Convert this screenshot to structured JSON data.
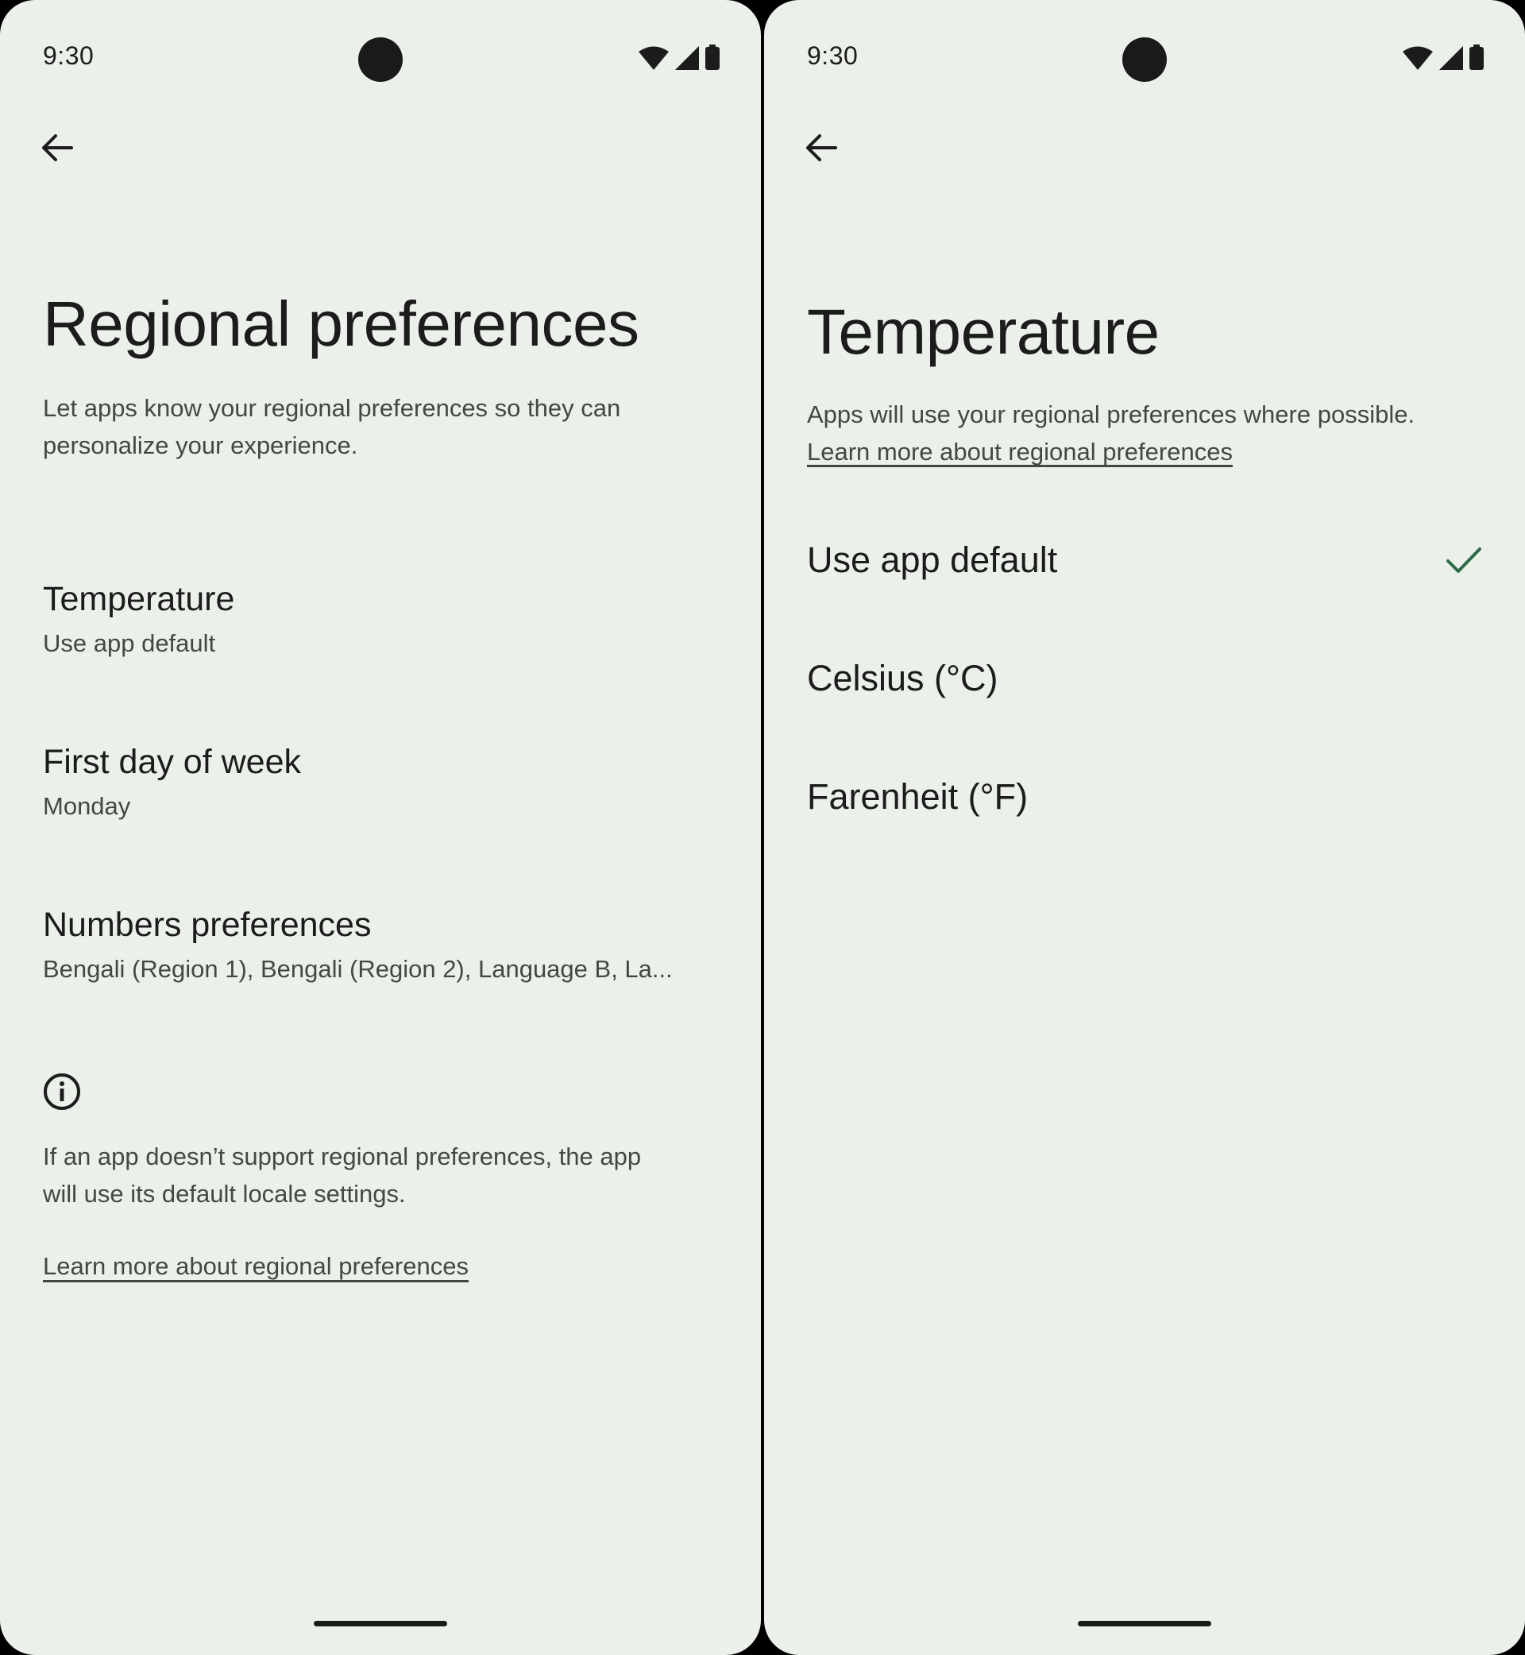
{
  "colors": {
    "background": "#ecf0eb",
    "text_primary": "#1b1c1b",
    "text_secondary": "#434843",
    "accent_check": "#2e6b48"
  },
  "left_screen": {
    "status_bar": {
      "time": "9:30",
      "icons": [
        "wifi-icon",
        "cellular-signal-icon",
        "battery-icon"
      ]
    },
    "back_icon": "arrow-back-icon",
    "title": "Regional preferences",
    "description": "Let apps know your regional preferences so they can personalize your experience.",
    "items": [
      {
        "title": "Temperature",
        "summary": "Use app default"
      },
      {
        "title": "First day of week",
        "summary": "Monday"
      },
      {
        "title": "Numbers preferences",
        "summary": "Bengali (Region 1), Bengali (Region 2), Language B, La..."
      }
    ],
    "footer": {
      "icon": "info-icon",
      "text": "If an app doesn’t support regional preferences, the app will use its default locale settings.",
      "link": "Learn more about regional preferences"
    }
  },
  "right_screen": {
    "status_bar": {
      "time": "9:30",
      "icons": [
        "wifi-icon",
        "cellular-signal-icon",
        "battery-icon"
      ]
    },
    "back_icon": "arrow-back-icon",
    "title": "Temperature",
    "description_prefix": "Apps will use your regional preferences where possible.",
    "description_link": "Learn more about regional preferences",
    "options": [
      {
        "label": "Use app default",
        "selected": true
      },
      {
        "label": "Celsius (°C)",
        "selected": false
      },
      {
        "label": "Farenheit (°F)",
        "selected": false
      }
    ]
  }
}
